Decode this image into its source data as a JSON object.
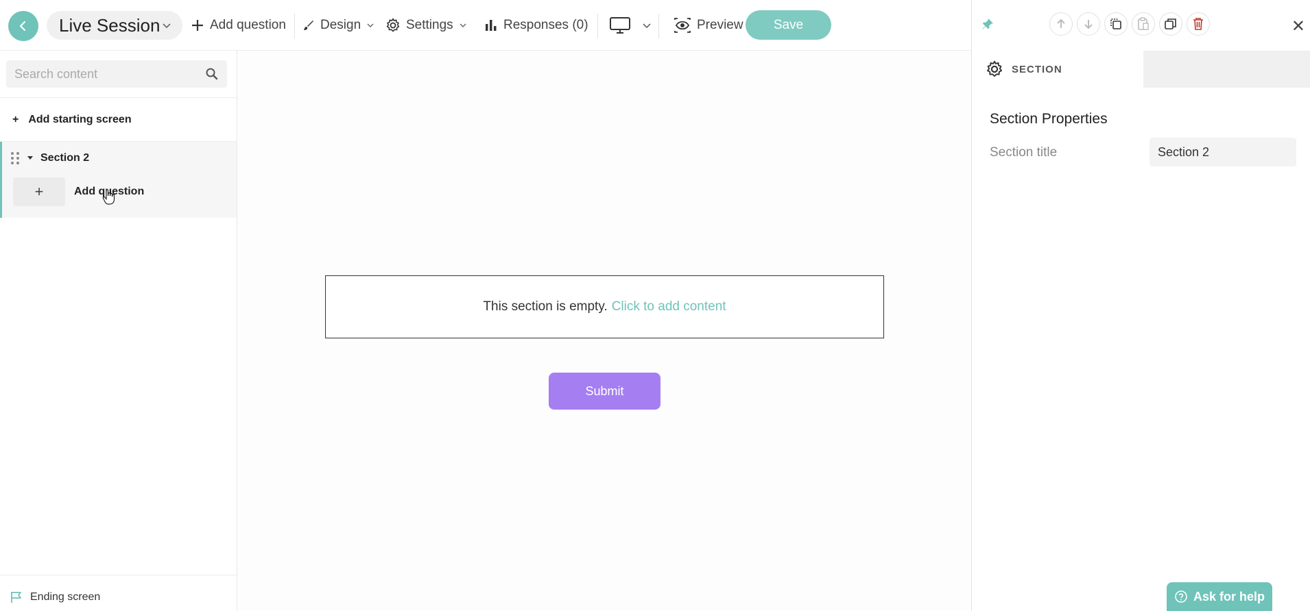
{
  "colors": {
    "accent": "#6fc3b9",
    "save": "#7fcac1",
    "submit": "#a57ef2",
    "delete": "#c0392b"
  },
  "header": {
    "title": "Live Session",
    "add_question": "Add question",
    "design": "Design",
    "settings": "Settings",
    "responses": "Responses (0)",
    "preview": "Preview",
    "save": "Save"
  },
  "sidebar": {
    "search_placeholder": "Search content",
    "add_starting_screen": "Add starting screen",
    "section_name": "Section 2",
    "add_question": "Add question",
    "ending_screen": "Ending screen"
  },
  "canvas": {
    "empty_text": "This section is empty.",
    "empty_link": "Click to add content",
    "submit": "Submit"
  },
  "panel": {
    "tab": "SECTION",
    "properties_title": "Section Properties",
    "title_label": "Section title",
    "title_value": "Section 2",
    "help": "Ask for help"
  }
}
